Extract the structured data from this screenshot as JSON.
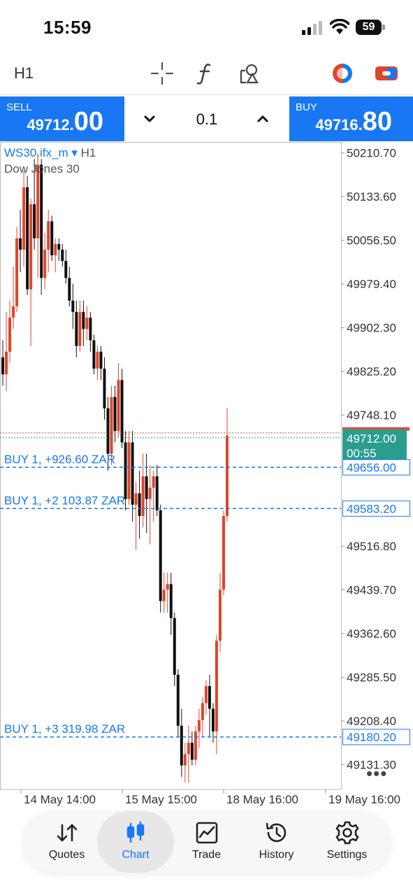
{
  "status_bar": {
    "time": "15:59",
    "battery": "59"
  },
  "toolbar": {
    "timeframe": "H1",
    "icons": [
      "crosshair-icon",
      "function-icon",
      "objects-icon",
      "trade-color-icon",
      "toggle-icon"
    ]
  },
  "trade": {
    "sell_label": "SELL",
    "sell_price_small": "49712.",
    "sell_price_big": "00",
    "buy_label": "BUY",
    "buy_price_small": "49716.",
    "buy_price_big": "80",
    "lot": "0.1"
  },
  "chart_header": {
    "symbol": "WS30.ifx_m",
    "symbol_arrow": "▾",
    "timeframe": "H1",
    "description": "Dow Jones 30"
  },
  "chart_data": {
    "type": "candlestick",
    "y_ticks": [
      "50210.70",
      "50133.60",
      "50056.50",
      "49979.40",
      "49902.30",
      "49825.20",
      "49748.10",
      "49516.80",
      "49439.70",
      "49362.60",
      "49285.50",
      "49208.40",
      "49131.30"
    ],
    "ylim": [
      49100,
      50230
    ],
    "x_ticks": [
      "14 May 14:00",
      "15 May 15:00",
      "18 May 16:00",
      "19 May 16:00"
    ],
    "bid_line": {
      "price": 49712.0,
      "countdown": "00:55",
      "color": "#2a9d8f"
    },
    "ask_line": {
      "price": 49716.8,
      "color": "#e74c3c"
    },
    "positions": [
      {
        "label": "BUY 1, +926.60 ZAR",
        "price_label": "49656.00",
        "price": 49656.0
      },
      {
        "label": "BUY 1, +2 103.87 ZAR",
        "price_label": "49583.20",
        "price": 49583.2
      },
      {
        "label": "BUY 1, +3 319.98 ZAR",
        "price_label": "49180.20",
        "price": 49180.2
      }
    ],
    "colors": {
      "up": "#e0452b",
      "down": "#111111",
      "position_line": "#1877f2"
    },
    "candles": [
      {
        "o": 49850,
        "h": 49880,
        "l": 49800,
        "c": 49820
      },
      {
        "o": 49820,
        "h": 49930,
        "l": 49790,
        "c": 49860
      },
      {
        "o": 49860,
        "h": 49950,
        "l": 49840,
        "c": 49920
      },
      {
        "o": 49920,
        "h": 50010,
        "l": 49900,
        "c": 49940
      },
      {
        "o": 49940,
        "h": 50080,
        "l": 49930,
        "c": 50060
      },
      {
        "o": 50060,
        "h": 50110,
        "l": 50000,
        "c": 50040
      },
      {
        "o": 50040,
        "h": 50180,
        "l": 50010,
        "c": 50150
      },
      {
        "o": 50150,
        "h": 50170,
        "l": 49960,
        "c": 49970
      },
      {
        "o": 49970,
        "h": 50130,
        "l": 49870,
        "c": 50120
      },
      {
        "o": 50120,
        "h": 50200,
        "l": 50040,
        "c": 50060
      },
      {
        "o": 50060,
        "h": 50210,
        "l": 49990,
        "c": 50190
      },
      {
        "o": 50190,
        "h": 50200,
        "l": 49960,
        "c": 49990
      },
      {
        "o": 49990,
        "h": 50070,
        "l": 49970,
        "c": 50040
      },
      {
        "o": 50040,
        "h": 50110,
        "l": 50000,
        "c": 50090
      },
      {
        "o": 50090,
        "h": 50100,
        "l": 50020,
        "c": 50030
      },
      {
        "o": 50030,
        "h": 50060,
        "l": 50000,
        "c": 50050
      },
      {
        "o": 50050,
        "h": 50060,
        "l": 50020,
        "c": 50040
      },
      {
        "o": 50040,
        "h": 50050,
        "l": 50010,
        "c": 50020
      },
      {
        "o": 50020,
        "h": 50040,
        "l": 49980,
        "c": 49990
      },
      {
        "o": 49990,
        "h": 50010,
        "l": 49940,
        "c": 49950
      },
      {
        "o": 49950,
        "h": 49980,
        "l": 49900,
        "c": 49930
      },
      {
        "o": 49930,
        "h": 49950,
        "l": 49850,
        "c": 49870
      },
      {
        "o": 49870,
        "h": 49950,
        "l": 49860,
        "c": 49930
      },
      {
        "o": 49930,
        "h": 49950,
        "l": 49870,
        "c": 49900
      },
      {
        "o": 49900,
        "h": 49940,
        "l": 49880,
        "c": 49920
      },
      {
        "o": 49920,
        "h": 49930,
        "l": 49860,
        "c": 49880
      },
      {
        "o": 49880,
        "h": 49890,
        "l": 49820,
        "c": 49830
      },
      {
        "o": 49830,
        "h": 49870,
        "l": 49810,
        "c": 49860
      },
      {
        "o": 49860,
        "h": 49870,
        "l": 49810,
        "c": 49830
      },
      {
        "o": 49830,
        "h": 49850,
        "l": 49740,
        "c": 49760
      },
      {
        "o": 49760,
        "h": 49780,
        "l": 49650,
        "c": 49680
      },
      {
        "o": 49680,
        "h": 49800,
        "l": 49660,
        "c": 49780
      },
      {
        "o": 49780,
        "h": 49800,
        "l": 49700,
        "c": 49720
      },
      {
        "o": 49720,
        "h": 49840,
        "l": 49710,
        "c": 49810
      },
      {
        "o": 49810,
        "h": 49830,
        "l": 49690,
        "c": 49700
      },
      {
        "o": 49700,
        "h": 49720,
        "l": 49580,
        "c": 49600
      },
      {
        "o": 49600,
        "h": 49720,
        "l": 49590,
        "c": 49700
      },
      {
        "o": 49700,
        "h": 49720,
        "l": 49560,
        "c": 49590
      },
      {
        "o": 49590,
        "h": 49630,
        "l": 49510,
        "c": 49610
      },
      {
        "o": 49610,
        "h": 49650,
        "l": 49530,
        "c": 49570
      },
      {
        "o": 49570,
        "h": 49680,
        "l": 49550,
        "c": 49640
      },
      {
        "o": 49640,
        "h": 49680,
        "l": 49540,
        "c": 49600
      },
      {
        "o": 49600,
        "h": 49660,
        "l": 49520,
        "c": 49620
      },
      {
        "o": 49620,
        "h": 49650,
        "l": 49560,
        "c": 49640
      },
      {
        "o": 49640,
        "h": 49660,
        "l": 49570,
        "c": 49580
      },
      {
        "o": 49580,
        "h": 49590,
        "l": 49400,
        "c": 49420
      },
      {
        "o": 49420,
        "h": 49470,
        "l": 49400,
        "c": 49440
      },
      {
        "o": 49440,
        "h": 49470,
        "l": 49400,
        "c": 49450
      },
      {
        "o": 49450,
        "h": 49470,
        "l": 49360,
        "c": 49390
      },
      {
        "o": 49390,
        "h": 49400,
        "l": 49270,
        "c": 49290
      },
      {
        "o": 49290,
        "h": 49300,
        "l": 49180,
        "c": 49200
      },
      {
        "o": 49200,
        "h": 49230,
        "l": 49110,
        "c": 49130
      },
      {
        "o": 49130,
        "h": 49170,
        "l": 49100,
        "c": 49150
      },
      {
        "o": 49150,
        "h": 49200,
        "l": 49100,
        "c": 49170
      },
      {
        "o": 49170,
        "h": 49190,
        "l": 49130,
        "c": 49140
      },
      {
        "o": 49140,
        "h": 49200,
        "l": 49130,
        "c": 49190
      },
      {
        "o": 49190,
        "h": 49230,
        "l": 49160,
        "c": 49210
      },
      {
        "o": 49210,
        "h": 49250,
        "l": 49180,
        "c": 49240
      },
      {
        "o": 49240,
        "h": 49280,
        "l": 49220,
        "c": 49270
      },
      {
        "o": 49270,
        "h": 49290,
        "l": 49180,
        "c": 49230
      },
      {
        "o": 49230,
        "h": 49240,
        "l": 49170,
        "c": 49190
      },
      {
        "o": 49190,
        "h": 49360,
        "l": 49150,
        "c": 49350
      },
      {
        "o": 49350,
        "h": 49470,
        "l": 49330,
        "c": 49440
      },
      {
        "o": 49440,
        "h": 49580,
        "l": 49430,
        "c": 49570
      },
      {
        "o": 49570,
        "h": 49760,
        "l": 49560,
        "c": 49712
      }
    ]
  },
  "menu": {
    "more": "•••"
  },
  "nav": {
    "items": [
      {
        "label": "Quotes"
      },
      {
        "label": "Chart"
      },
      {
        "label": "Trade"
      },
      {
        "label": "History"
      },
      {
        "label": "Settings"
      }
    ]
  }
}
